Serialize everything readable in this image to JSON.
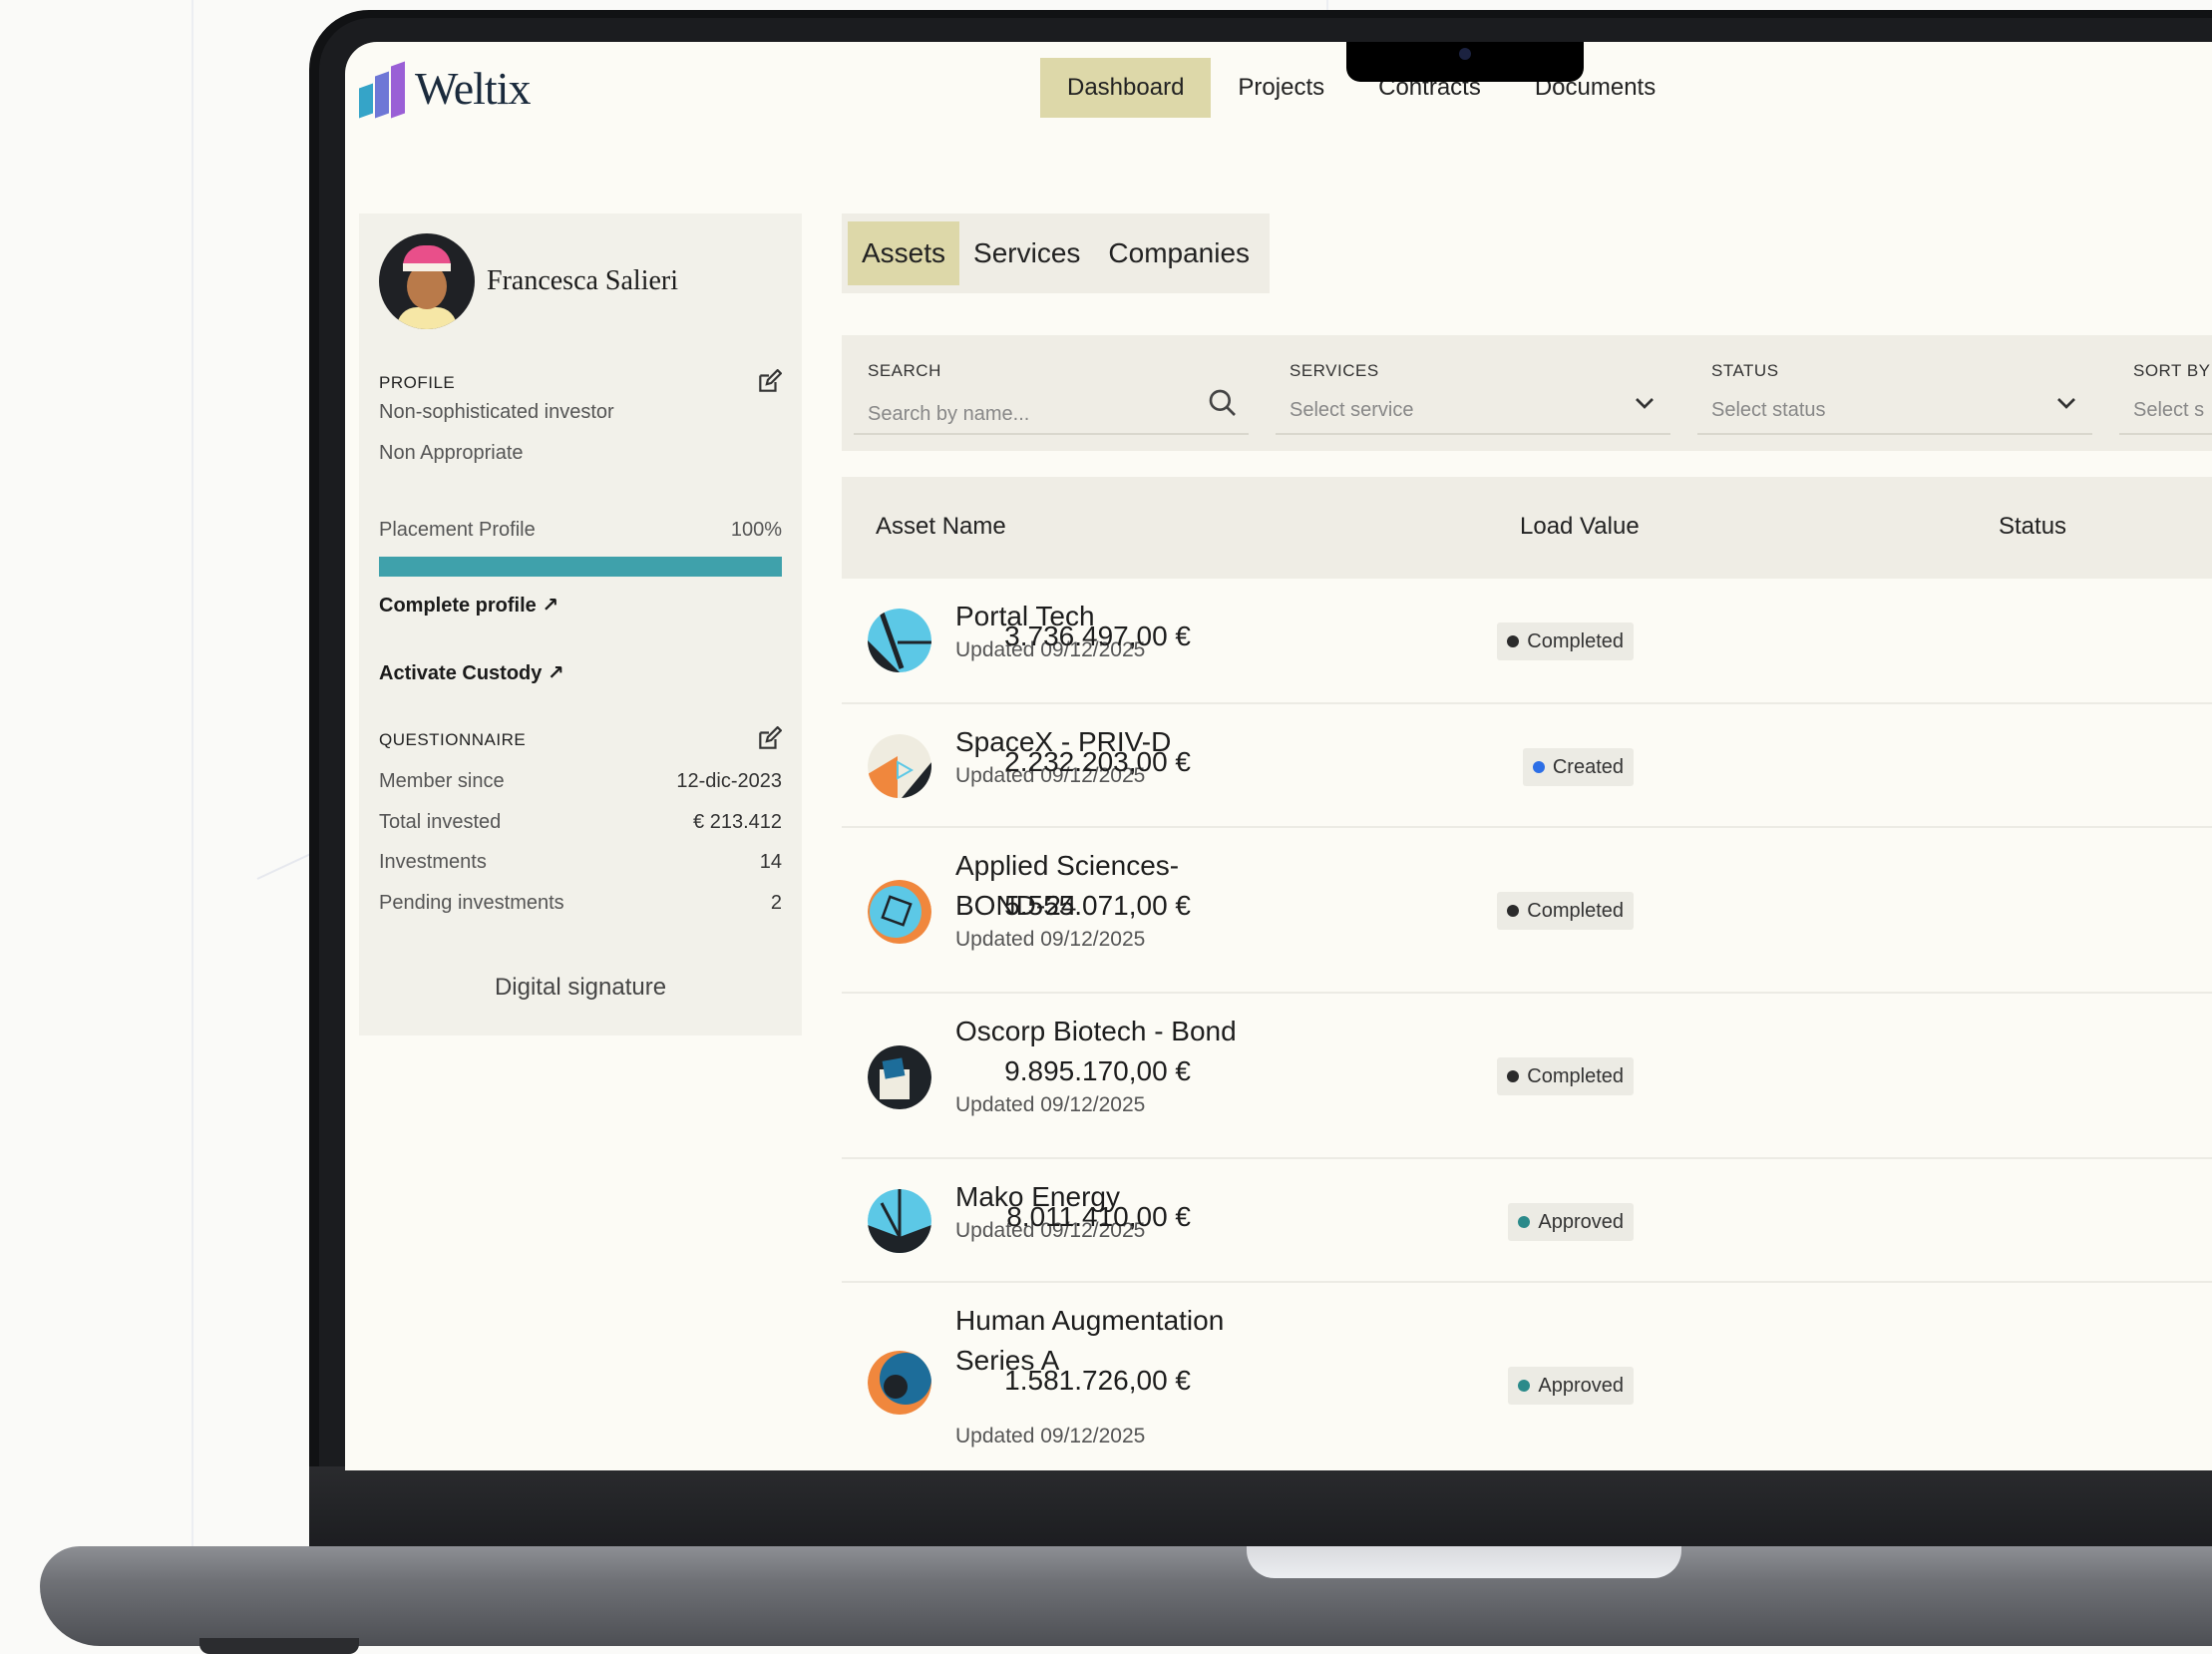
{
  "brand": {
    "name": "Weltix"
  },
  "nav": [
    {
      "label": "Dashboard",
      "active": true
    },
    {
      "label": "Projects",
      "active": false
    },
    {
      "label": "Contracts",
      "active": false
    },
    {
      "label": "Documents",
      "active": false
    }
  ],
  "profile": {
    "name": "Francesca Salieri",
    "profile_label": "PROFILE",
    "investor_type": "Non-sophisticated investor",
    "appropriateness": "Non Appropriate",
    "placement_label": "Placement Profile",
    "placement_percent": "100%",
    "placement_fraction": 1.0,
    "complete_link": "Complete profile ↗",
    "custody_link": "Activate Custody ↗",
    "questionnaire_label": "QUESTIONNAIRE",
    "stats": [
      {
        "label": "Member since",
        "value": "12-dic-2023"
      },
      {
        "label": "Total invested",
        "value": "€ 213.412"
      },
      {
        "label": "Investments",
        "value": "14"
      },
      {
        "label": "Pending investments",
        "value": "2"
      }
    ],
    "signature_label": "Digital signature"
  },
  "subtabs": [
    {
      "label": "Assets",
      "active": true
    },
    {
      "label": "Services",
      "active": false
    },
    {
      "label": "Companies",
      "active": false
    }
  ],
  "filters": {
    "search": {
      "label": "SEARCH",
      "placeholder": "Search by name..."
    },
    "services": {
      "label": "SERVICES",
      "value": "Select service"
    },
    "status": {
      "label": "STATUS",
      "value": "Select status"
    },
    "sort": {
      "label": "SORT BY",
      "value": "Select s"
    }
  },
  "table": {
    "headers": {
      "name": "Asset Name",
      "value": "Load Value",
      "status": "Status"
    },
    "rows": [
      {
        "name": "Portal Tech",
        "updated": "Updated 09/12/2025",
        "value": "3.736.497,00 €",
        "status": "Completed",
        "status_color": "#2b2b2b",
        "icon": "portal-tech-logo-icon"
      },
      {
        "name": "SpaceX - PRIV-D",
        "updated": "Updated 09/12/2025",
        "value": "2.232.203,00 €",
        "status": "Created",
        "status_color": "#2d6fe6",
        "icon": "spacex-logo-icon"
      },
      {
        "name": "Applied Sciences-BOND-24",
        "updated": "Updated 09/12/2025",
        "value": "5.555.071,00 €",
        "status": "Completed",
        "status_color": "#2b2b2b",
        "icon": "applied-sciences-logo-icon"
      },
      {
        "name": "Oscorp Biotech - Bond",
        "updated": "Updated 09/12/2025",
        "value": "9.895.170,00 €",
        "status": "Completed",
        "status_color": "#2b2b2b",
        "icon": "oscorp-logo-icon"
      },
      {
        "name": "Mako Energy",
        "updated": "Updated 09/12/2025",
        "value": "8.011.410,00 €",
        "status": "Approved",
        "status_color": "#2b8a8a",
        "icon": "mako-energy-logo-icon"
      },
      {
        "name": "Human Augmentation Series A",
        "updated": "Updated 09/12/2025",
        "value": "1.581.726,00 €",
        "status": "Approved",
        "status_color": "#2b8a8a",
        "icon": "human-augmentation-logo-icon"
      }
    ]
  }
}
